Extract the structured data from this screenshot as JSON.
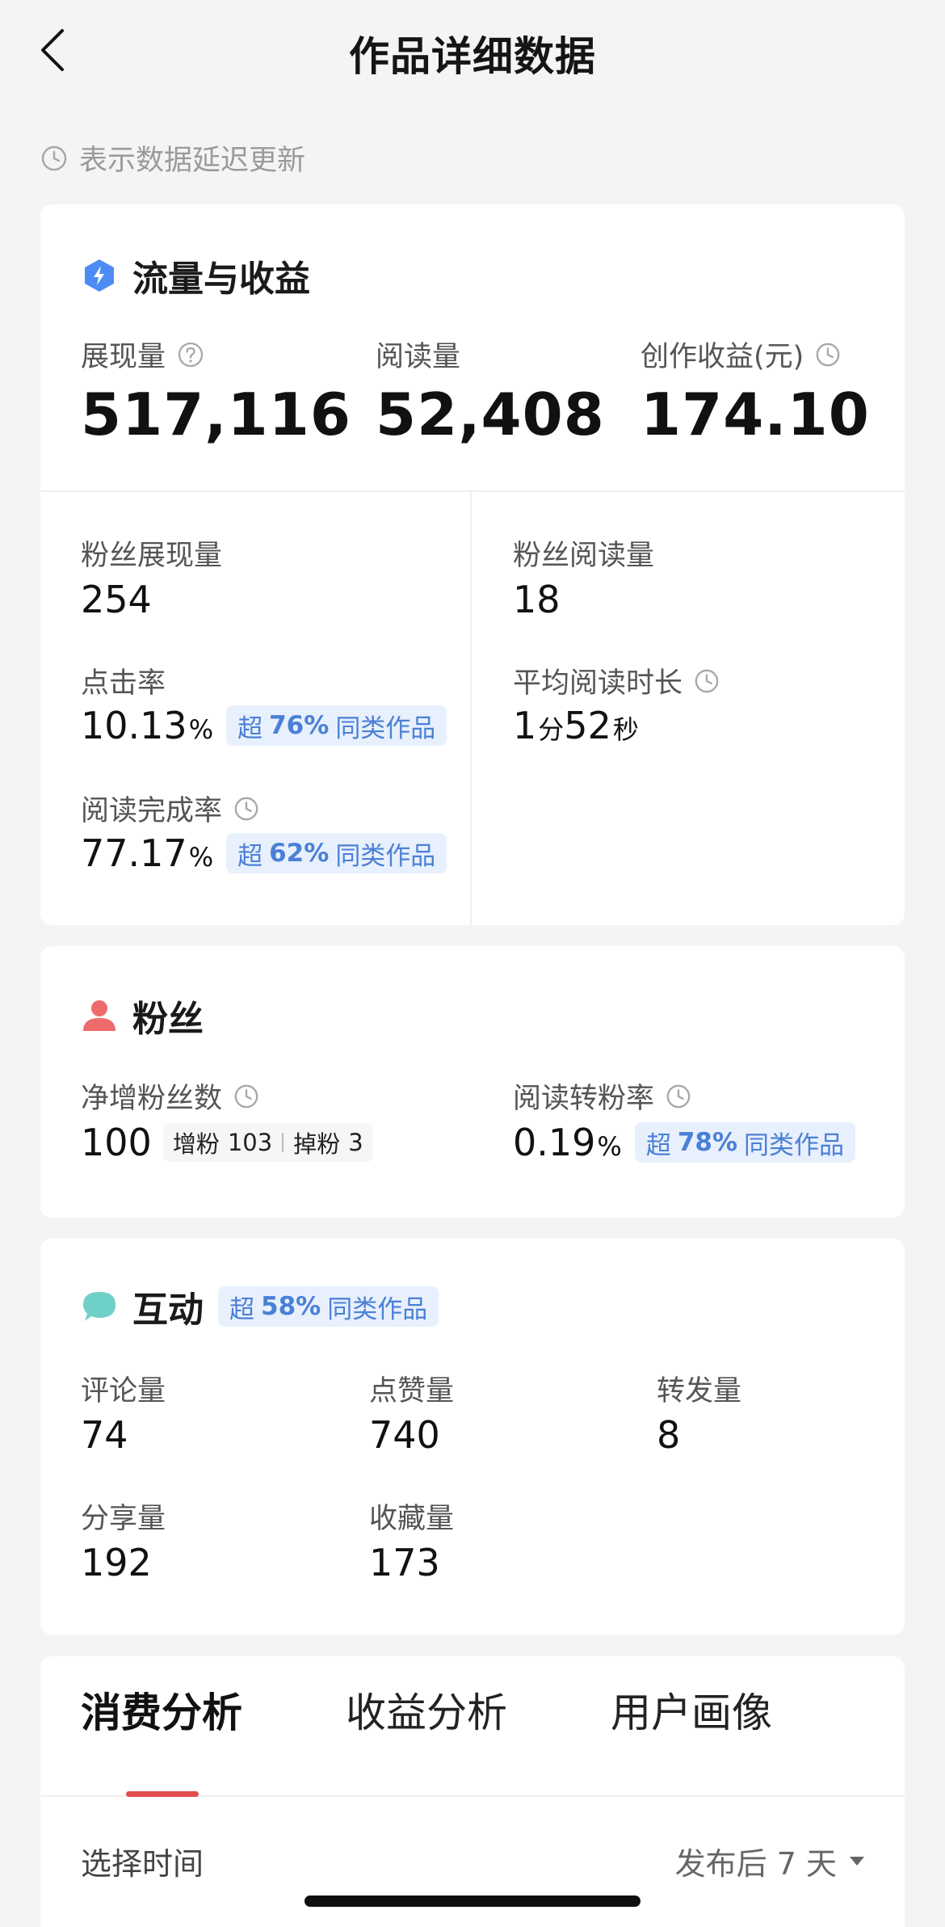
{
  "header": {
    "title": "作品详细数据"
  },
  "delay_note": "表示数据延迟更新",
  "traffic": {
    "title": "流量与收益",
    "impressions_label": "展现量",
    "impressions_value": "517,116",
    "reads_label": "阅读量",
    "reads_value": "52,408",
    "earnings_label": "创作收益(元)",
    "earnings_value": "174.10",
    "fan_impressions_label": "粉丝展现量",
    "fan_impressions_value": "254",
    "fan_reads_label": "粉丝阅读量",
    "fan_reads_value": "18",
    "ctr_label": "点击率",
    "ctr_value": "10.13",
    "ctr_unit": "%",
    "ctr_badge": {
      "prefix": "超",
      "percent": "76%",
      "suffix": "同类作品"
    },
    "avg_read_label": "平均阅读时长",
    "avg_read": {
      "min": "1",
      "min_unit": "分",
      "sec": "52",
      "sec_unit": "秒"
    },
    "completion_label": "阅读完成率",
    "completion_value": "77.17",
    "completion_unit": "%",
    "completion_badge": {
      "prefix": "超",
      "percent": "62%",
      "suffix": "同类作品"
    }
  },
  "fans": {
    "title": "粉丝",
    "net_label": "净增粉丝数",
    "net_value": "100",
    "gain_label": "增粉",
    "gain_value": "103",
    "loss_label": "掉粉",
    "loss_value": "3",
    "conv_label": "阅读转粉率",
    "conv_value": "0.19",
    "conv_unit": "%",
    "conv_badge": {
      "prefix": "超",
      "percent": "78%",
      "suffix": "同类作品"
    }
  },
  "interaction": {
    "title": "互动",
    "badge": {
      "prefix": "超",
      "percent": "58%",
      "suffix": "同类作品"
    },
    "comments_label": "评论量",
    "comments_value": "74",
    "likes_label": "点赞量",
    "likes_value": "740",
    "reposts_label": "转发量",
    "reposts_value": "8",
    "shares_label": "分享量",
    "shares_value": "192",
    "favorites_label": "收藏量",
    "favorites_value": "173"
  },
  "tabs": [
    {
      "label": "消费分析"
    },
    {
      "label": "收益分析"
    },
    {
      "label": "用户画像"
    }
  ],
  "time_select": {
    "label": "选择时间",
    "value": "发布后 7 天"
  },
  "colors": {
    "accent_red": "#e34b4b",
    "badge_bg": "#e8f0fd",
    "badge_text": "#4a80d6",
    "traffic_icon": "#4d8cf5",
    "fans_icon": "#ef6b6b",
    "interaction_icon": "#6fd0c8"
  }
}
